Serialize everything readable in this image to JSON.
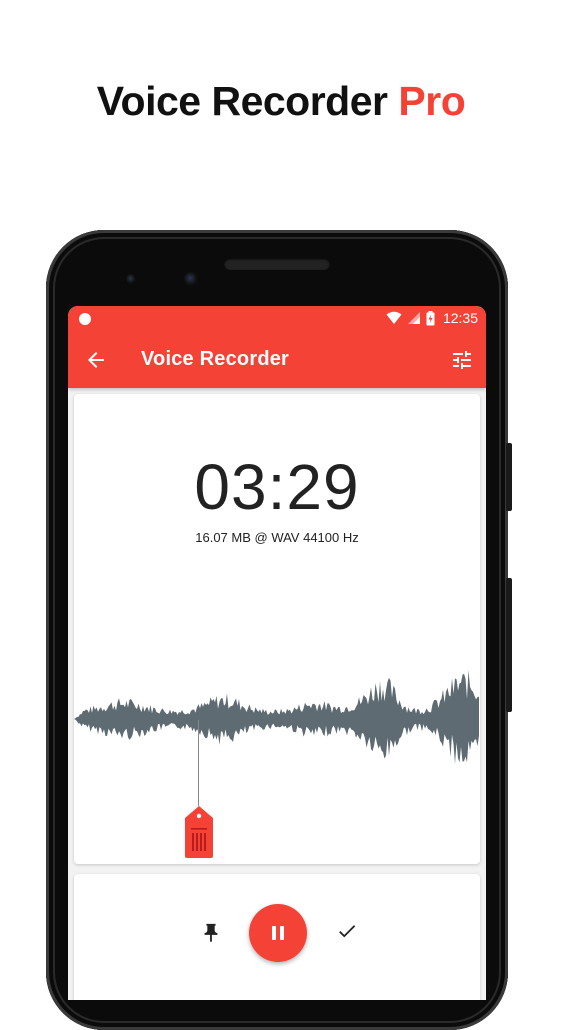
{
  "promo": {
    "title_main": "Voice Recorder ",
    "title_accent": "Pro",
    "accent_color": "#f44336"
  },
  "status_bar": {
    "time": "12:35",
    "icons": [
      "notification-dot-icon",
      "wifi-icon",
      "signal-icon",
      "battery-charging-icon"
    ]
  },
  "app_bar": {
    "title": "Voice Recorder",
    "back_icon": "arrow-back-icon",
    "settings_icon": "tune-sliders-icon",
    "color": "#f44336"
  },
  "recorder": {
    "elapsed": "03:29",
    "file_info": "16.07 MB @ WAV 44100 Hz"
  },
  "controls": {
    "pin_icon": "pin-icon",
    "pause_icon": "pause-icon",
    "done_icon": "check-icon"
  }
}
